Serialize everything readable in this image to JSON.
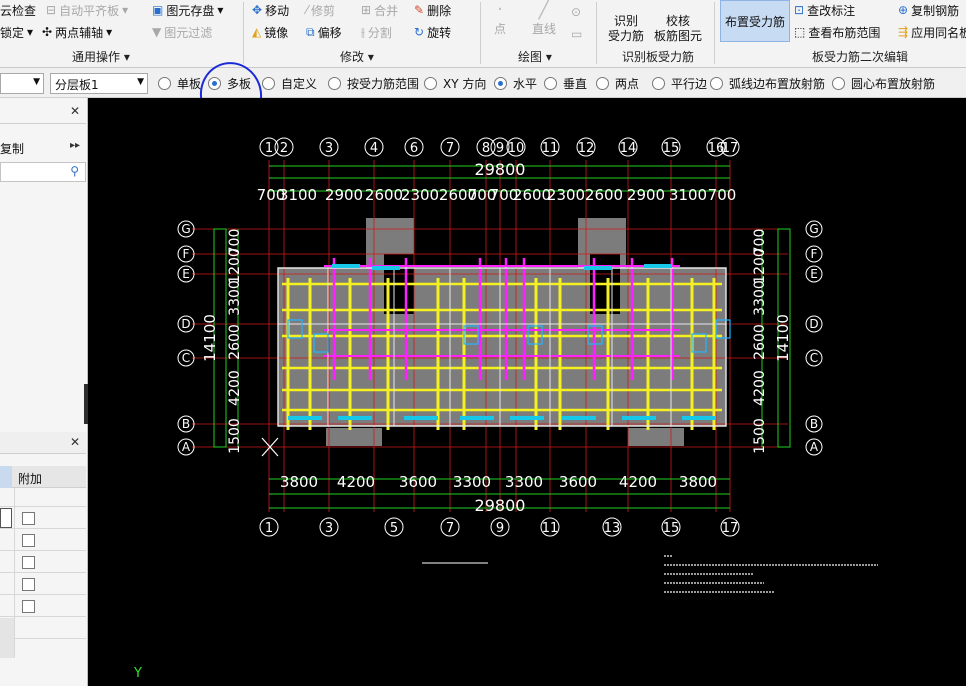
{
  "ribbon": {
    "row1": {
      "cloud_check": "云检查",
      "auto_align": "自动平齐板",
      "save_elem": "图元存盘",
      "move": "移动",
      "trim": "修剪",
      "merge": "合并",
      "delete": "删除"
    },
    "row2": {
      "lock": "锁定",
      "two_point_axis": "两点辅轴",
      "elem_filter": "图元过滤",
      "mirror": "镜像",
      "offset": "偏移",
      "split": "分割",
      "rotate": "旋转"
    },
    "groups": {
      "common_ops": "通用操作",
      "modify": "修改",
      "draw": "绘图",
      "identify_slab": "识别板受力筋",
      "slab_rebar_edit": "板受力筋二次编辑"
    },
    "draw": {
      "point": "点",
      "line": "直线"
    },
    "identify": {
      "ident_line1": "识别",
      "ident_line2": "受力筋",
      "check_line1": "校核",
      "check_line2": "板筋图元"
    },
    "arrange_rebar": "布置受力筋",
    "edit": {
      "check_mark": "查改标注",
      "view_range": "查看布筋范围",
      "copy_rebar": "复制钢筋",
      "apply_same": "应用同名板"
    }
  },
  "optbar": {
    "combo_left": "",
    "layer_combo": "分层板1",
    "options": [
      {
        "label": "单板",
        "checked": false
      },
      {
        "label": "多板",
        "checked": true
      },
      {
        "label": "自定义",
        "checked": false
      },
      {
        "label": "按受力筋范围",
        "checked": false
      },
      {
        "label": "XY 方向",
        "checked": false
      },
      {
        "label": "水平",
        "checked": true
      },
      {
        "label": "垂直",
        "checked": false
      },
      {
        "label": "两点",
        "checked": false
      },
      {
        "label": "平行边",
        "checked": false
      },
      {
        "label": "弧线边布置放射筋",
        "checked": false
      },
      {
        "label": "圆心布置放射筋",
        "checked": false
      }
    ]
  },
  "left_panel": {
    "copy_label": "复制",
    "col_attach": "附加"
  },
  "drawing": {
    "axis_y_label": "Y",
    "top_axes": [
      "1",
      "2",
      "3",
      "4",
      "6",
      "7",
      "8",
      "9",
      "10",
      "11",
      "12",
      "14",
      "15",
      "16",
      "17"
    ],
    "bottom_axes": [
      "1",
      "3",
      "5",
      "7",
      "9",
      "11",
      "13",
      "15",
      "17"
    ],
    "row_axes": [
      "G",
      "F",
      "E",
      "D",
      "C",
      "B",
      "A"
    ],
    "total_dim": "29800",
    "top_dims": [
      "700",
      "3100",
      "2900",
      "2600",
      "2300",
      "2600",
      "700",
      "700",
      "2600",
      "2300",
      "2600",
      "2900",
      "3100",
      "700"
    ],
    "bottom_dims": [
      "3800",
      "4200",
      "3600",
      "3300",
      "3300",
      "3600",
      "4200",
      "3800"
    ],
    "left_dims": [
      "700",
      "1200",
      "3300",
      "2600",
      "4200",
      "1500"
    ],
    "left_total": "14100",
    "right_dims": [
      "700",
      "1200",
      "3300",
      "2600",
      "4200",
      "1500"
    ],
    "right_total": "14100"
  }
}
